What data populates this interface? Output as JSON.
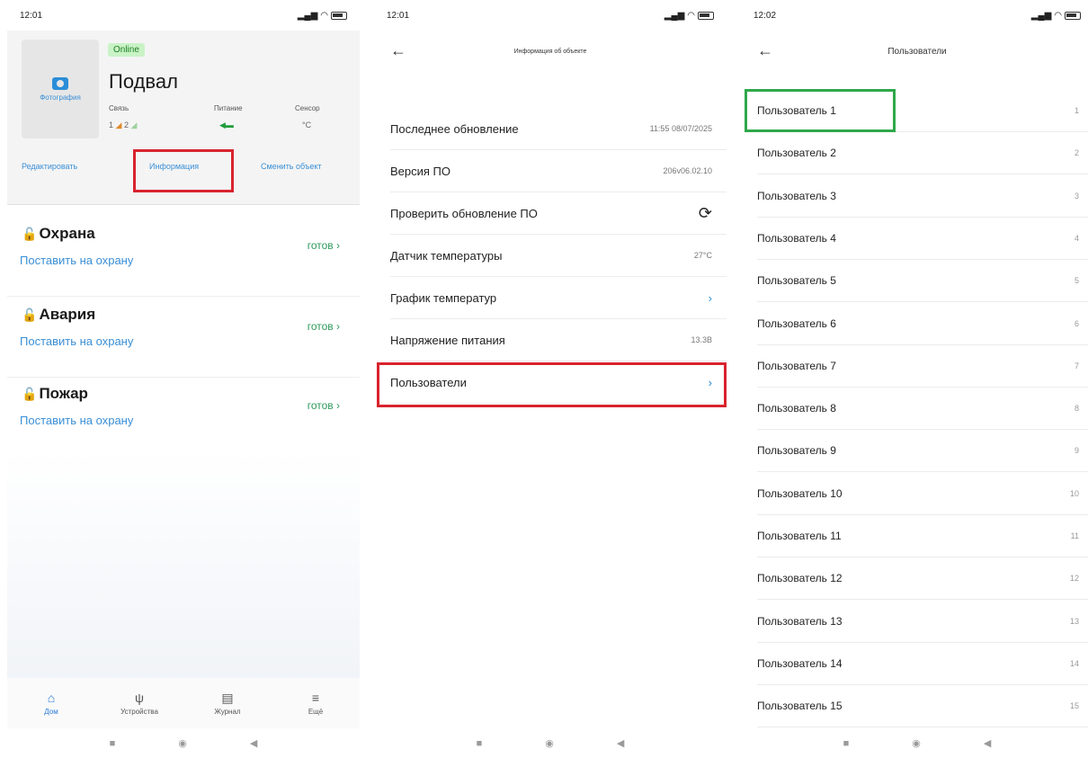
{
  "p1": {
    "status": {
      "time": "12:01"
    },
    "photo_label": "Фотография",
    "online": "Online",
    "title": "Подвал",
    "meta": {
      "link_label": "Связь",
      "link_val": "1",
      "link_val2": "2",
      "power_label": "Питание",
      "sensor_label": "Сенсор",
      "sensor_val": "°C"
    },
    "actions": {
      "edit": "Редактировать",
      "info": "Информация",
      "change": "Сменить объект"
    },
    "sections": [
      {
        "title": "Охрана",
        "link": "Поставить на охрану",
        "status": "готов"
      },
      {
        "title": "Авария",
        "link": "Поставить на охрану",
        "status": "готов"
      },
      {
        "title": "Пожар",
        "link": "Поставить на охрану",
        "status": "готов"
      }
    ],
    "tabs": [
      {
        "label": "Дом",
        "icon": "home-icon"
      },
      {
        "label": "Устройства",
        "icon": "plug-icon"
      },
      {
        "label": "Журнал",
        "icon": "journal-icon"
      },
      {
        "label": "Ещё",
        "icon": "menu-icon"
      }
    ]
  },
  "p2": {
    "status": {
      "time": "12:01"
    },
    "title": "Информация об объекте",
    "rows": [
      {
        "label": "Последнее обновление",
        "value": "11:55 08/07/2025"
      },
      {
        "label": "Версия ПО",
        "value": "206v06.02.10"
      },
      {
        "label": "Проверить обновление ПО",
        "value": ""
      },
      {
        "label": "Датчик температуры",
        "value": "27°C"
      },
      {
        "label": "График температур",
        "value": ""
      },
      {
        "label": "Напряжение питания",
        "value": "13.3В"
      },
      {
        "label": "Пользователи",
        "value": ""
      }
    ]
  },
  "p3": {
    "status": {
      "time": "12:02"
    },
    "title": "Пользователи",
    "users": [
      {
        "label": "Пользователь 1",
        "num": "1"
      },
      {
        "label": "Пользователь 2",
        "num": "2"
      },
      {
        "label": "Пользователь 3",
        "num": "3"
      },
      {
        "label": "Пользователь 4",
        "num": "4"
      },
      {
        "label": "Пользователь 5",
        "num": "5"
      },
      {
        "label": "Пользователь 6",
        "num": "6"
      },
      {
        "label": "Пользователь 7",
        "num": "7"
      },
      {
        "label": "Пользователь 8",
        "num": "8"
      },
      {
        "label": "Пользователь 9",
        "num": "9"
      },
      {
        "label": "Пользователь 10",
        "num": "10"
      },
      {
        "label": "Пользователь 11",
        "num": "11"
      },
      {
        "label": "Пользователь 12",
        "num": "12"
      },
      {
        "label": "Пользователь 13",
        "num": "13"
      },
      {
        "label": "Пользователь 14",
        "num": "14"
      },
      {
        "label": "Пользователь 15",
        "num": "15"
      }
    ]
  },
  "colors": {
    "accent": "#3a8fd6",
    "highlight_red": "#d9232e",
    "highlight_green": "#2fa84a",
    "ready_green": "#2e9a5b"
  }
}
